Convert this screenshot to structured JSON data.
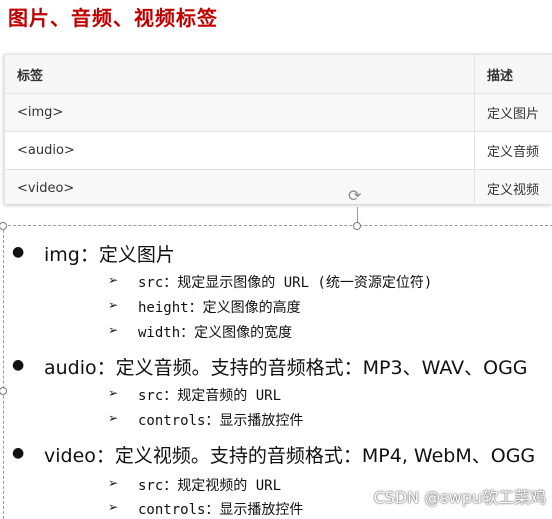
{
  "title": "图片、音频、视频标签",
  "table": {
    "headers": [
      "标签",
      "描述"
    ],
    "rows": [
      [
        "<img>",
        "定义图片"
      ],
      [
        "<audio>",
        "定义音频"
      ],
      [
        "<video>",
        "定义视频"
      ]
    ]
  },
  "bullets": [
    {
      "label": "img：定义图片",
      "sub": [
        "src：规定显示图像的 URL (统一资源定位符)",
        "height：定义图像的高度",
        "width：定义图像的宽度"
      ]
    },
    {
      "label": "audio：定义音频。支持的音频格式：MP3、WAV、OGG",
      "sub": [
        "src：规定音频的 URL",
        "controls：显示播放控件"
      ]
    },
    {
      "label": "video：定义视频。支持的音频格式：MP4, WebM、OGG",
      "sub": [
        "src：规定视频的 URL",
        "controls：显示播放控件"
      ]
    }
  ],
  "glyphs": {
    "bullet": "●",
    "arrow": "➢",
    "rotate": "⟳"
  },
  "watermark": "CSDN @swpu软工菜鸡"
}
